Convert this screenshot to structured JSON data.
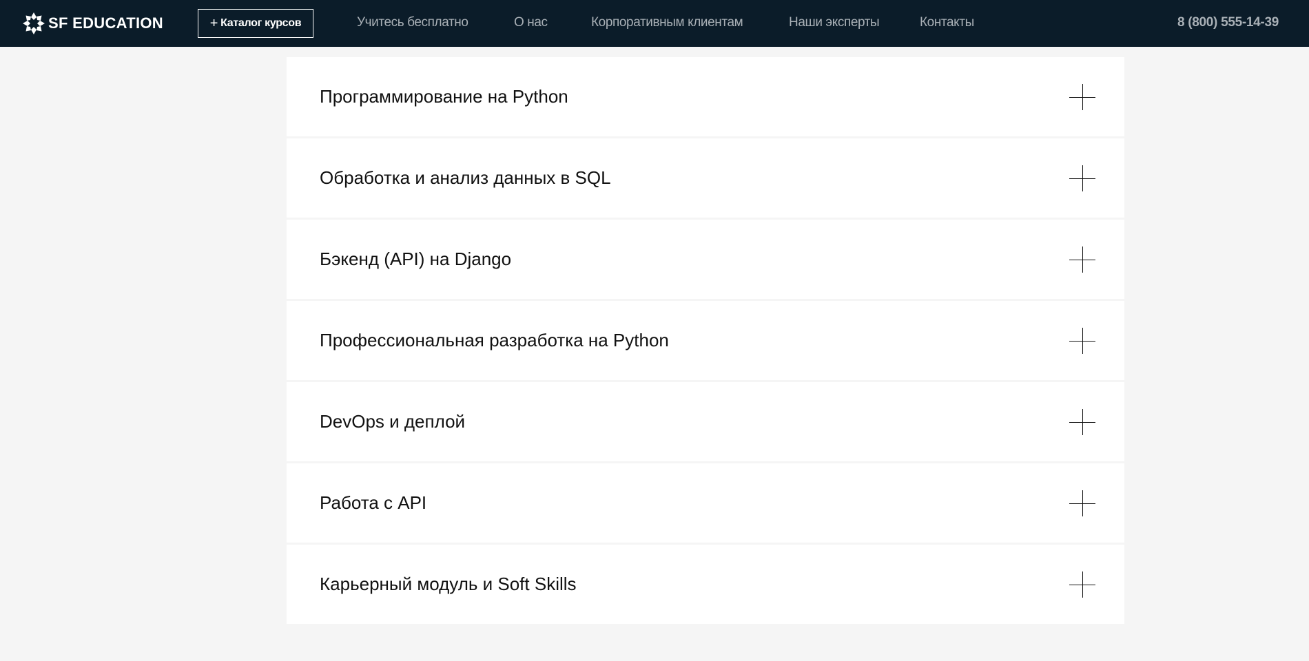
{
  "header": {
    "logo_text": "SF EDUCATION",
    "catalog_button": {
      "icon": "+",
      "label": "Каталог курсов"
    },
    "nav": [
      {
        "label": "Учитесь бесплатно"
      },
      {
        "label": "О нас"
      },
      {
        "label": "Корпоративным клиентам"
      },
      {
        "label": "Наши эксперты"
      },
      {
        "label": "Контакты"
      }
    ],
    "phone": "8 (800) 555-14-39"
  },
  "accordion": {
    "items": [
      {
        "title": "Программирование на Python"
      },
      {
        "title": "Обработка и анализ данных в SQL"
      },
      {
        "title": "Бэкенд (API) на Django"
      },
      {
        "title": "Профессиональная разработка на Python"
      },
      {
        "title": "DevOps и деплой"
      },
      {
        "title": "Работа с API"
      },
      {
        "title": "Карьерный модуль и Soft Skills"
      }
    ],
    "expand_icon": "plus-icon"
  },
  "colors": {
    "header_bg": "#0b1c29",
    "page_bg": "#f5f5f5",
    "card_bg": "#ffffff",
    "nav_text": "#a9b0b6",
    "title_text": "#111111"
  }
}
